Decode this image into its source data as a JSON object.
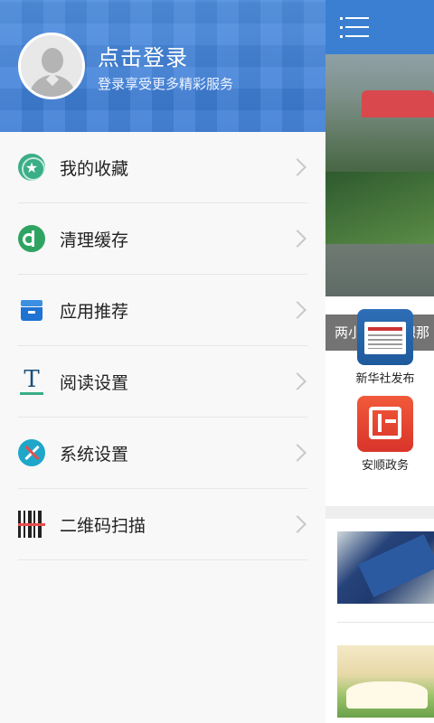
{
  "profile": {
    "login_title": "点击登录",
    "login_subtitle": "登录享受更多精彩服务"
  },
  "menu": {
    "items": [
      {
        "label": "我的收藏",
        "icon": "star-icon"
      },
      {
        "label": "清理缓存",
        "icon": "clean-icon"
      },
      {
        "label": "应用推荐",
        "icon": "app-box-icon"
      },
      {
        "label": "阅读设置",
        "icon": "text-icon"
      },
      {
        "label": "系统设置",
        "icon": "tools-icon"
      },
      {
        "label": "二维码扫描",
        "icon": "qrcode-icon"
      }
    ]
  },
  "content": {
    "hero_caption": "两小伙：没想那",
    "apps": [
      {
        "name": "新华社发布",
        "icon": "xinhua-news-icon"
      },
      {
        "name": "安顺政务",
        "icon": "government-icon"
      }
    ]
  },
  "colors": {
    "header_blue": "#3d7ed6",
    "topbar_blue": "#3a7fd2",
    "accent_green": "#3aae86"
  }
}
